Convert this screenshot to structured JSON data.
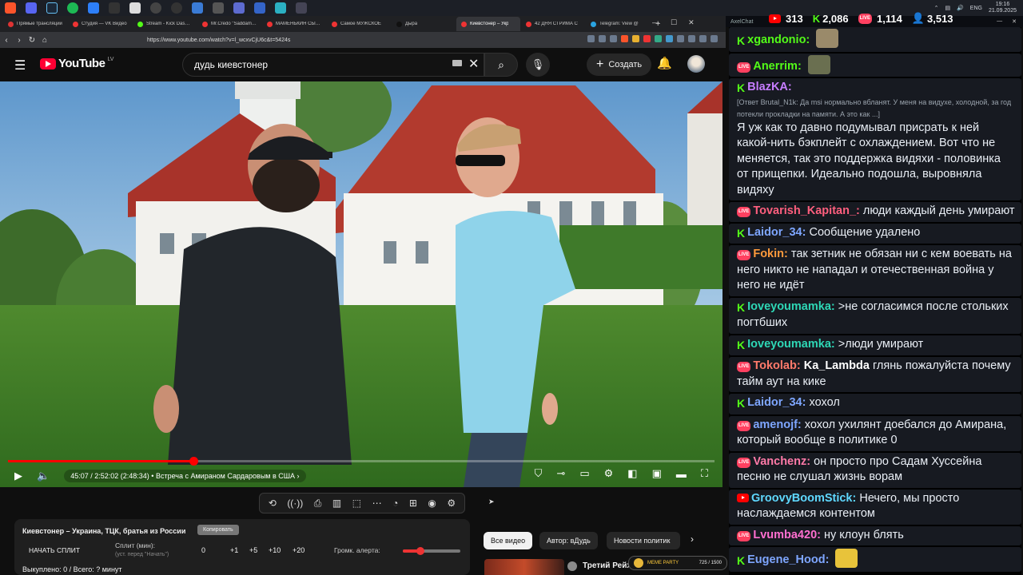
{
  "taskbar": {
    "time": "19:16",
    "date": "21.09.2025",
    "lang": "ENG"
  },
  "browser": {
    "tabs": [
      {
        "title": "Прямые трансляции",
        "fav": "#d33"
      },
      {
        "title": "Студия — VK Видео",
        "fav": "#e33"
      },
      {
        "title": "Stream - Kick Dashboard",
        "fav": "#53fc18"
      },
      {
        "title": "Mr.Credo \"Saddam Hussein\"",
        "fav": "#e33"
      },
      {
        "title": "МАМЕНЬКИН СЫНОК",
        "fav": "#e33"
      },
      {
        "title": "Самое МУЖСКОЕ",
        "fav": "#e33"
      },
      {
        "title": "Дыра",
        "fav": "#111"
      },
      {
        "title": "Киевстонер – Укр",
        "fav": "#e33",
        "active": true
      },
      {
        "title": "42 ДНЯ СТРИМА С",
        "fav": "#e33"
      },
      {
        "title": "Telegram: View @",
        "fav": "#2aa3e0"
      }
    ],
    "url": "https://www.youtube.com/watch?v=l_wcxvCjU6c&t=5424s"
  },
  "youtube": {
    "logo": "YouTube",
    "country": "LV",
    "search_value": "дудь киевстонер",
    "create_label": "Создать"
  },
  "player": {
    "progress_fraction": 0.262,
    "time_text": "45:07 / 2:52:02 (2:48:34)",
    "chapter": "Встреча с Амираном Сардаровым в США"
  },
  "split": {
    "title": "Киевстонер – Украина, ТЦК, братья из России",
    "copy_label": "Копировать",
    "start_label": "НАЧАТЬ СПЛИТ",
    "split_label": "Сплит (мин):",
    "split_hint": "(уст. перед \"Начать\")",
    "split_value": "0",
    "increments": [
      "+1",
      "+5",
      "+10",
      "+20"
    ],
    "volume_label": "Громк. алерта:",
    "volume_fraction": 0.3,
    "stats": "Выкуплено: 0 / Всего: ? минут"
  },
  "chips": [
    {
      "label": "Все видео",
      "active": true
    },
    {
      "label": "Автор: вДудь"
    },
    {
      "label": "Новости политик"
    }
  ],
  "related": {
    "title": "Третий Рейх"
  },
  "meme_widget": {
    "label": "MEME PARTY",
    "count": "725 / 1500"
  },
  "chat_app": {
    "title": "AxelChat"
  },
  "stats": {
    "youtube": "313",
    "kick": "2,086",
    "live": "1,114",
    "total": "3,513"
  },
  "chat": [
    {
      "platform": "kick",
      "user": "xgandonio:",
      "color": "#53fc18",
      "text": "",
      "emote": "#9a8a6a"
    },
    {
      "platform": "live",
      "user": "Anerrim:",
      "color": "#53fc18",
      "text": "",
      "emote": "#6a6f50"
    },
    {
      "platform": "kick",
      "user": "BlazKA:",
      "color": "#c77dff",
      "reply": "[Ответ Brutal_N1k: Да msi нормально вбланят. У меня на видухе, холодной, за год потекли прокладки на памяти. А это как ...]",
      "text": "Я уж как то давно подумывал присрать к ней какой-нить бэкплейт с охлаждением. Вот что не меняется, так это поддержка видяхи - половинка от прищепки. Идеально подошла, выровняла видяху"
    },
    {
      "platform": "live",
      "user": "Tovarish_Kapitan_:",
      "color": "#ff5f7e",
      "text": "люди каждый день умирают"
    },
    {
      "platform": "kick",
      "user": "Laidor_34:",
      "color": "#7ea6ff",
      "text": "Сообщение удалено"
    },
    {
      "platform": "live",
      "user": "Fokin:",
      "color": "#ff9a3c",
      "text": "так зетник не обязан ни с кем воевать на него никто не нападал и отечественная война у него не идёт"
    },
    {
      "platform": "kick",
      "user": "Ioveyoumamka:",
      "color": "#2ed8b6",
      "text": ">не согласимся после стольких погтбших"
    },
    {
      "platform": "kick",
      "user": "Ioveyoumamka:",
      "color": "#2ed8b6",
      "text": ">люди умирают"
    },
    {
      "platform": "live",
      "user": "Tokolab:",
      "color": "#ff7a6b",
      "text": "Ka_Lambda глянь пожалуйста почему тайм аут на кике",
      "mention": "Ka_Lambda"
    },
    {
      "platform": "kick",
      "user": "Laidor_34:",
      "color": "#7ea6ff",
      "text": "хохол"
    },
    {
      "platform": "live",
      "user": "amenojf:",
      "color": "#7ea6ff",
      "text": "хохол ухилянт доебался до Амирана, который вообще в политике 0"
    },
    {
      "platform": "live",
      "user": "Vanchenz:",
      "color": "#ff7aa8",
      "text": "он просто про Садам Хуссейна песню не слушал жизнь ворам"
    },
    {
      "platform": "yt",
      "user": "GroovyBoomStick:",
      "color": "#5fd8ff",
      "text": "Нечего, мы просто наслаждаемся контентом"
    },
    {
      "platform": "live",
      "user": "Lvumba420:",
      "color": "#ff6fd0",
      "text": "ну клоун блять"
    },
    {
      "platform": "kick",
      "user": "Eugene_Hood:",
      "color": "#7ea6ff",
      "text": "",
      "emote": "#e8c33a"
    }
  ]
}
